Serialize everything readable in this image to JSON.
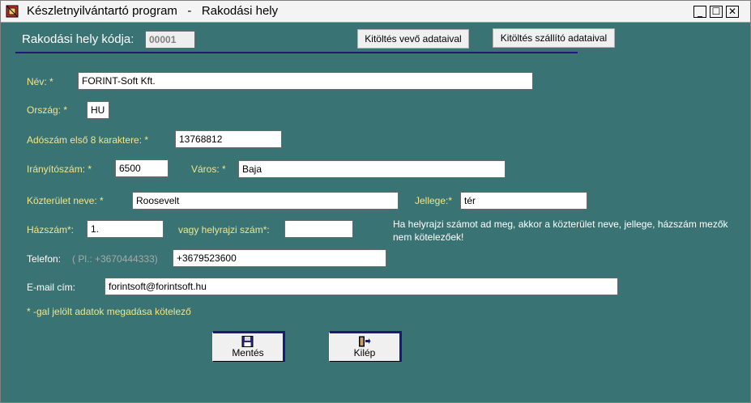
{
  "window": {
    "title": "Készletnyilvántartó program   -   Rakodási hely",
    "min_label": "_",
    "max_label": "☐",
    "close_label": "✕"
  },
  "header": {
    "code_label": "Rakodási hely kódja:",
    "code_value": "00001",
    "fill_customer_label": "Kitöltés vevő adataival",
    "fill_supplier_label": "Kitöltés szállító adataival"
  },
  "form": {
    "name_label": "Név: *",
    "name_value": "FORINT-Soft Kft.",
    "country_label": "Ország: *",
    "country_value": "HU",
    "tax_label": "Adószám első 8 karaktere: *",
    "tax_value": "13768812",
    "zip_label": "Irányítószám: *",
    "zip_value": "6500",
    "city_label": "Város: *",
    "city_value": "Baja",
    "street_label": "Közterület neve: *",
    "street_value": "Roosevelt",
    "street_type_label": "Jellege:*",
    "street_type_value": "tér",
    "house_label": "Házszám*:",
    "house_value": "1.",
    "lot_label": "vagy helyrajzi szám*:",
    "lot_value": "",
    "note_line1": "Ha helyrajzi számot ad meg, akkor a közterület neve, jellege, házszám mezők",
    "note_line2": "nem kötelezőek!",
    "phone_label": "Telefon:",
    "phone_hint": "( Pl.: +3670444333)",
    "phone_value": "+3679523600",
    "email_label": "E-mail cím:",
    "email_value": "forintsoft@forintsoft.hu",
    "required_note": "* -gal jelölt adatok megadása kötelező"
  },
  "buttons": {
    "save_label": "Mentés",
    "exit_label": "Kilép"
  },
  "colors": {
    "background": "#3a7373",
    "label": "#f0e68c",
    "accent": "#1a1a7a"
  }
}
